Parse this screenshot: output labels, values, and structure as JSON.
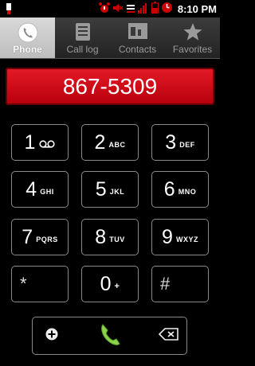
{
  "status_bar": {
    "time": "8:10",
    "ampm": "PM",
    "icons": [
      "usb-icon",
      "alarm-icon",
      "mute-icon",
      "vibrate-icon",
      "signal-icon",
      "battery-icon",
      "clock-icon"
    ]
  },
  "tabs": [
    {
      "label": "Phone",
      "icon": "phone-icon",
      "active": true
    },
    {
      "label": "Call log",
      "icon": "call-log-icon",
      "active": false
    },
    {
      "label": "Contacts",
      "icon": "contacts-icon",
      "active": false
    },
    {
      "label": "Favorites",
      "icon": "star-icon",
      "active": false
    }
  ],
  "dialed_number": "867-5309",
  "keypad": {
    "k1": {
      "digit": "1",
      "letters": "oo"
    },
    "k2": {
      "digit": "2",
      "letters": "ABC"
    },
    "k3": {
      "digit": "3",
      "letters": "DEF"
    },
    "k4": {
      "digit": "4",
      "letters": "GHI"
    },
    "k5": {
      "digit": "5",
      "letters": "JKL"
    },
    "k6": {
      "digit": "6",
      "letters": "MNO"
    },
    "k7": {
      "digit": "7",
      "letters": "PQRS"
    },
    "k8": {
      "digit": "8",
      "letters": "TUV"
    },
    "k9": {
      "digit": "9",
      "letters": "WXYZ"
    },
    "kstar": {
      "digit": "*",
      "letters": ""
    },
    "k0": {
      "digit": "0",
      "letters": "+"
    },
    "khash": {
      "digit": "#",
      "letters": ""
    }
  },
  "actions": {
    "add_contact_icon": "add-contact-icon",
    "call_icon": "call-icon",
    "delete_icon": "backspace-icon"
  },
  "colors": {
    "display_red": "#d0101c",
    "call_green": "#8bd34a"
  }
}
